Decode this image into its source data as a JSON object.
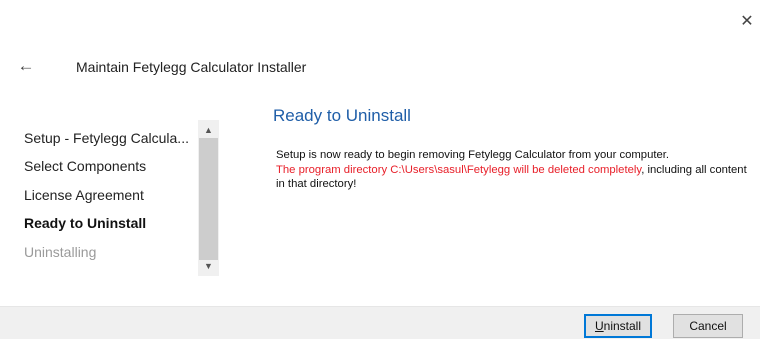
{
  "window": {
    "title": "Maintain Fetylegg Calculator Installer",
    "close_glyph": "✕",
    "back_glyph": "←"
  },
  "steps": [
    {
      "label": "Setup - Fetylegg Calcula...",
      "state": "done"
    },
    {
      "label": "Select Components",
      "state": "done"
    },
    {
      "label": "License Agreement",
      "state": "done"
    },
    {
      "label": "Ready to Uninstall",
      "state": "current"
    },
    {
      "label": "Uninstalling",
      "state": "disabled"
    }
  ],
  "scrollbar": {
    "up_glyph": "▲",
    "down_glyph": "▼"
  },
  "page": {
    "heading": "Ready to Uninstall",
    "line1": "Setup is now ready to begin removing Fetylegg Calculator from your computer.",
    "warning": "The program directory C:\\Users\\sasul\\Fetylegg will be deleted completely",
    "line2_rest": ", including all content in that directory!"
  },
  "buttons": {
    "uninstall_first": "U",
    "uninstall_rest": "ninstall",
    "cancel": "Cancel"
  },
  "colors": {
    "heading": "#1f5ea8",
    "warning": "#e8202a",
    "footer": "#f0f0f0",
    "focus_border": "#0078d7"
  }
}
